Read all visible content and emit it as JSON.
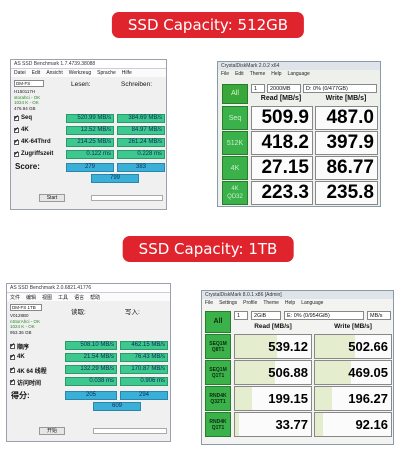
{
  "banners": {
    "top": "SSD Capacity: 512GB",
    "bottom": "SSD Capacity: 1TB"
  },
  "as_ssd_1": {
    "title": "AS SSD Benchmark 1.7.4739.38088",
    "menu": [
      "Datei",
      "Edit",
      "Ansicht",
      "Werkzeug",
      "Sprache",
      "Hilfe"
    ],
    "drive": "DM-FS",
    "info": [
      "H150117H",
      "storahci - OK",
      "1024 K - OK",
      "476.94 GB"
    ],
    "read_header": "Lesen:",
    "write_header": "Schreiben:",
    "rows": [
      {
        "label": "Seq",
        "read": "520.99 MB/s",
        "write": "384.69 MB/s"
      },
      {
        "label": "4K",
        "read": "12.52 MB/s",
        "write": "84.97 MB/s"
      },
      {
        "label": "4K-64Thrd",
        "read": "214.25 MB/s",
        "write": "261.24 MB/s"
      },
      {
        "label": "Zugriffszeit",
        "read": "0.122 ms",
        "write": "0.228 ms"
      }
    ],
    "score_label": "Score:",
    "score_read": "279",
    "score_write": "383",
    "score_total": "799",
    "start": "Start"
  },
  "as_ssd_2": {
    "title": "AS SSD Benchmark 2.0.6821.41776",
    "menu": [
      "文件",
      "编辑",
      "视图",
      "工具",
      "语言",
      "帮助"
    ],
    "drive": "DM-FS 1TB",
    "info": [
      "V0128B0",
      "nStorAhci - OK",
      "1024 K - OK",
      "953.36 GB"
    ],
    "read_header": "读取:",
    "write_header": "写入:",
    "rows": [
      {
        "label": "顺序",
        "read": "508.10 MB/s",
        "write": "462.15 MB/s"
      },
      {
        "label": "4K",
        "read": "21.54 MB/s",
        "write": "76.43 MB/s"
      },
      {
        "label": "4K 64 线程",
        "read": "132.29 MB/s",
        "write": "170.87 MB/s"
      },
      {
        "label": "访问时间",
        "read": "0.038 ms",
        "write": "0.906 ms"
      }
    ],
    "score_label": "得分:",
    "score_read": "205",
    "score_write": "294",
    "score_total": "609",
    "start": "开始"
  },
  "cdm_1": {
    "title": "CrystalDiskMark 2.0.2 x64",
    "menu": [
      "File",
      "Edit",
      "Theme",
      "Help",
      "Language"
    ],
    "all": "All",
    "runs": "1",
    "size": "2000MB",
    "drive": "D: 0% (0/477GB)",
    "read_header": "Read [MB/s]",
    "write_header": "Write [MB/s]",
    "rows": [
      {
        "label": "Seq",
        "read": "509.9",
        "write": "487.0"
      },
      {
        "label": "512K",
        "read": "418.2",
        "write": "397.9"
      },
      {
        "label": "4K",
        "read": "27.15",
        "write": "86.77"
      },
      {
        "label": "4K\nQD32",
        "read": "223.3",
        "write": "235.8"
      }
    ]
  },
  "cdm_2": {
    "title": "CrystalDiskMark 8.0.1 x86 [Admin]",
    "menu": [
      "File",
      "Settings",
      "Profile",
      "Theme",
      "Help",
      "Language"
    ],
    "all": "All",
    "runs": "1",
    "size": "2GiB",
    "drive": "E: 0% (0/954GiB)",
    "unit": "MB/s",
    "read_header": "Read [MB/s]",
    "write_header": "Write [MB/s]",
    "rows": [
      {
        "label1": "SEQ1M",
        "label2": "Q8T1",
        "read": "539.12",
        "write": "502.66",
        "read_frac": 0.55,
        "write_frac": 0.52
      },
      {
        "label1": "SEQ1M",
        "label2": "Q1T1",
        "read": "506.88",
        "write": "469.05",
        "read_frac": 0.52,
        "write_frac": 0.48
      },
      {
        "label1": "RND4K",
        "label2": "Q32T1",
        "read": "199.15",
        "write": "196.27",
        "read_frac": 0.22,
        "write_frac": 0.22
      },
      {
        "label1": "RND4K",
        "label2": "Q1T1",
        "read": "33.77",
        "write": "92.16",
        "read_frac": 0.05,
        "write_frac": 0.1
      }
    ]
  }
}
